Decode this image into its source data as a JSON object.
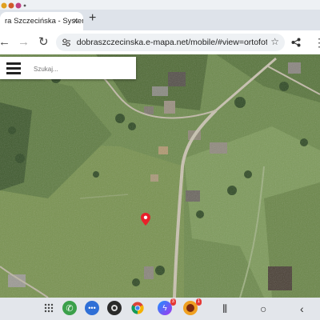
{
  "browser": {
    "tab_title": "ra Szczecińska - System",
    "tab_close": "×",
    "new_tab": "+",
    "url": "dobraszczecinska.e-mapa.net/mobile/#view=ortofoto"
  },
  "map": {
    "search_placeholder": "Szukaj..."
  },
  "taskbar": {
    "apps": [
      "app-grid",
      "phone",
      "messages",
      "camera",
      "chrome",
      "messenger",
      "game"
    ],
    "messenger_badge": "3",
    "game_badge": "1"
  },
  "colors": {
    "pin": "#e8202a",
    "accent": "#1a73e8"
  }
}
